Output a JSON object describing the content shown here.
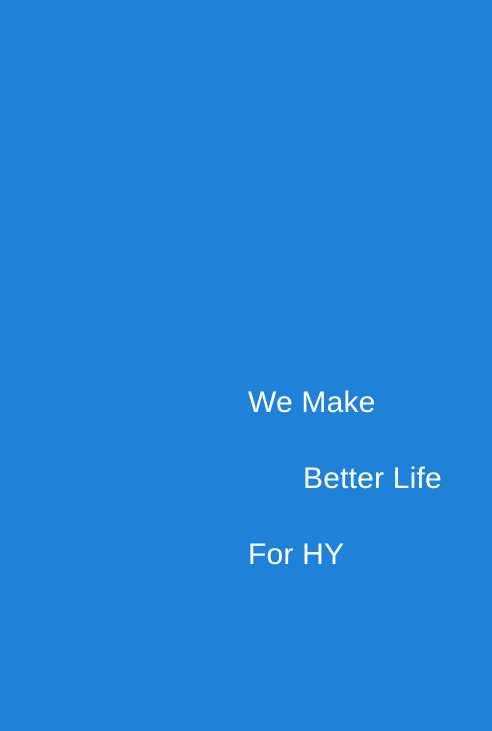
{
  "tagline": {
    "line_1": "We Make",
    "line_2": "Better Life",
    "line_3": "For HY"
  },
  "colors": {
    "background": "#1f82d8",
    "text": "#ffffff"
  }
}
